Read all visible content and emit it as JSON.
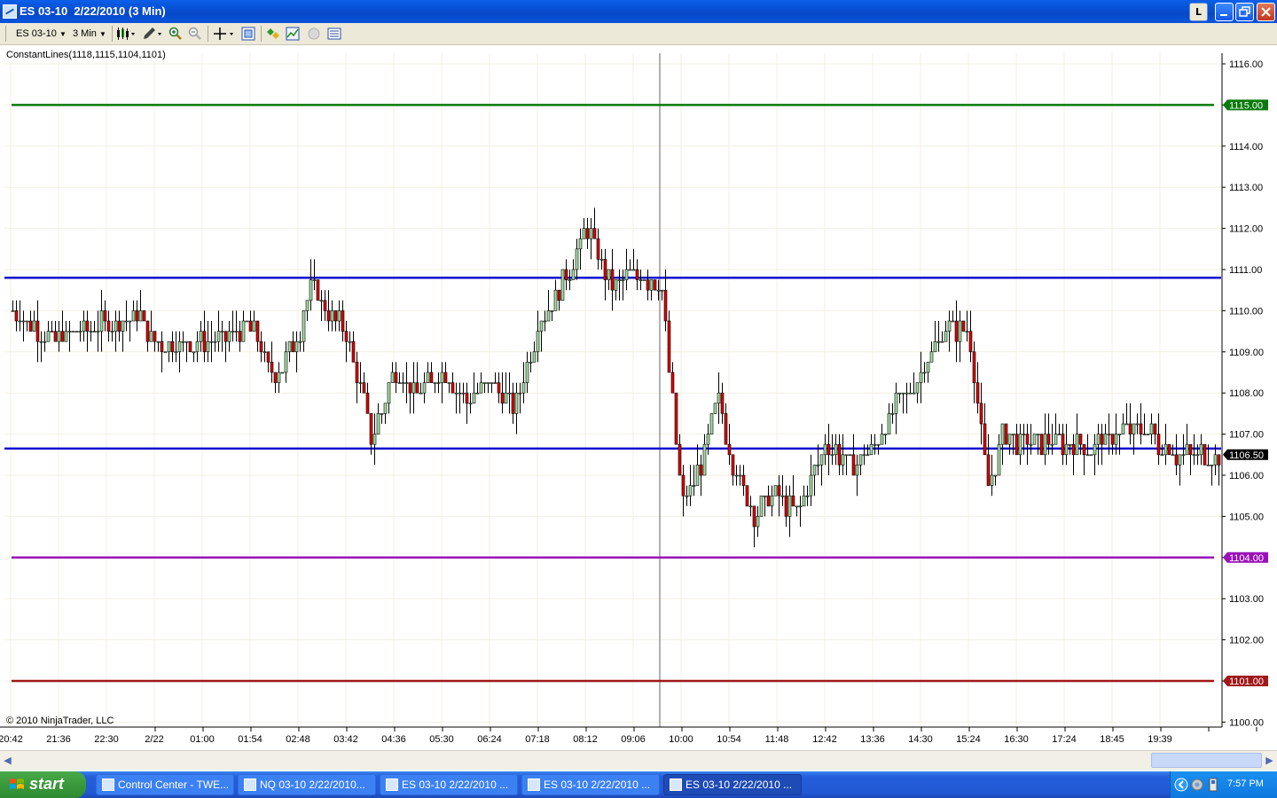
{
  "window": {
    "title": "ES 03-10  2/22/2010 (3 Min)"
  },
  "title_buttons": {
    "l_label": "L"
  },
  "toolbar": {
    "instrument": "ES 03-10",
    "interval": "3 Min"
  },
  "chart": {
    "indicator_label": "ConstantLines(1118,1115,1104,1101)",
    "copyright": "© 2010 NinjaTrader, LLC"
  },
  "taskbar": {
    "start_label": "start",
    "tasks": [
      "Control Center - TWE...",
      "NQ 03-10  2/22/2010...",
      "ES 03-10  2/22/2010 ...",
      "ES 03-10  2/22/2010 ...",
      "ES 03-10  2/22/2010 ..."
    ],
    "clock": "7:57 PM"
  },
  "colors": {
    "line_green": "#0a7a0a",
    "line_blue": "#0a0ad0",
    "line_purple": "#9a10b8",
    "line_red": "#a01818",
    "candle_up": "#a4dfa4",
    "candle_down": "#dd0000"
  },
  "chart_data": {
    "type": "candlestick",
    "instrument": "ES 03-10",
    "interval": "3 Min",
    "y_ticks": [
      "1116.00",
      "1115.00",
      "1114.00",
      "1113.00",
      "1112.00",
      "1111.00",
      "1110.00",
      "1109.00",
      "1108.00",
      "1107.00",
      "1106.00",
      "1105.00",
      "1104.00",
      "1103.00",
      "1102.00",
      "1101.00",
      "1100.00"
    ],
    "ylim": [
      1100,
      1116
    ],
    "x_ticks": [
      "20:42",
      "21:36",
      "22:30",
      "2/22",
      "01:00",
      "01:54",
      "02:48",
      "03:42",
      "04:36",
      "05:30",
      "06:24",
      "07:18",
      "08:12",
      "09:06",
      "10:00",
      "10:54",
      "11:48",
      "12:42",
      "13:36",
      "14:30",
      "15:24",
      "16:30",
      "17:24",
      "18:45",
      "19:39"
    ],
    "horizontal_lines": [
      {
        "value": 1115.0,
        "label": "1115.00",
        "color": "#0a7a0a"
      },
      {
        "value": 1110.8,
        "label": "",
        "color": "#0a0ad0"
      },
      {
        "value": 1106.65,
        "label": "",
        "color": "#0a0ad0"
      },
      {
        "value": 1104.0,
        "label": "1104.00",
        "color": "#9a10b8"
      },
      {
        "value": 1101.0,
        "label": "1101.00",
        "color": "#a01818"
      }
    ],
    "last_price": {
      "value": 1106.5,
      "label": "1106.50"
    },
    "crosshair_time": "09:36",
    "price_path": [
      [
        "20:42",
        1110.0
      ],
      [
        "21:30",
        1109.3
      ],
      [
        "22:30",
        1109.7
      ],
      [
        "23:30",
        1109.9
      ],
      [
        "2/22",
        1109.2
      ],
      [
        "01:00",
        1109.2
      ],
      [
        "01:54",
        1109.6
      ],
      [
        "02:20",
        1108.3
      ],
      [
        "02:48",
        1109.5
      ],
      [
        "03:00",
        1110.6
      ],
      [
        "03:42",
        1109.4
      ],
      [
        "04:10",
        1106.9
      ],
      [
        "04:36",
        1108.6
      ],
      [
        "05:00",
        1107.9
      ],
      [
        "05:30",
        1108.5
      ],
      [
        "06:00",
        1107.8
      ],
      [
        "06:24",
        1108.3
      ],
      [
        "06:50",
        1107.6
      ],
      [
        "07:18",
        1109.7
      ],
      [
        "07:50",
        1110.8
      ],
      [
        "08:12",
        1112.0
      ],
      [
        "08:40",
        1110.6
      ],
      [
        "09:06",
        1110.9
      ],
      [
        "09:36",
        1110.6
      ],
      [
        "10:00",
        1105.2
      ],
      [
        "10:20",
        1106.2
      ],
      [
        "10:40",
        1107.9
      ],
      [
        "10:54",
        1106.5
      ],
      [
        "11:20",
        1105.1
      ],
      [
        "11:48",
        1105.5
      ],
      [
        "12:10",
        1105.0
      ],
      [
        "12:42",
        1106.8
      ],
      [
        "13:10",
        1106.2
      ],
      [
        "13:36",
        1106.7
      ],
      [
        "14:00",
        1107.6
      ],
      [
        "14:30",
        1108.6
      ],
      [
        "15:00",
        1109.6
      ],
      [
        "15:24",
        1109.4
      ],
      [
        "15:50",
        1105.6
      ],
      [
        "16:10",
        1107.0
      ],
      [
        "16:30",
        1106.8
      ],
      [
        "17:00",
        1106.8
      ],
      [
        "17:24",
        1106.8
      ],
      [
        "18:00",
        1106.6
      ],
      [
        "18:45",
        1107.0
      ],
      [
        "19:20",
        1107.2
      ],
      [
        "19:39",
        1106.7
      ],
      [
        "19:50",
        1106.5
      ]
    ]
  }
}
